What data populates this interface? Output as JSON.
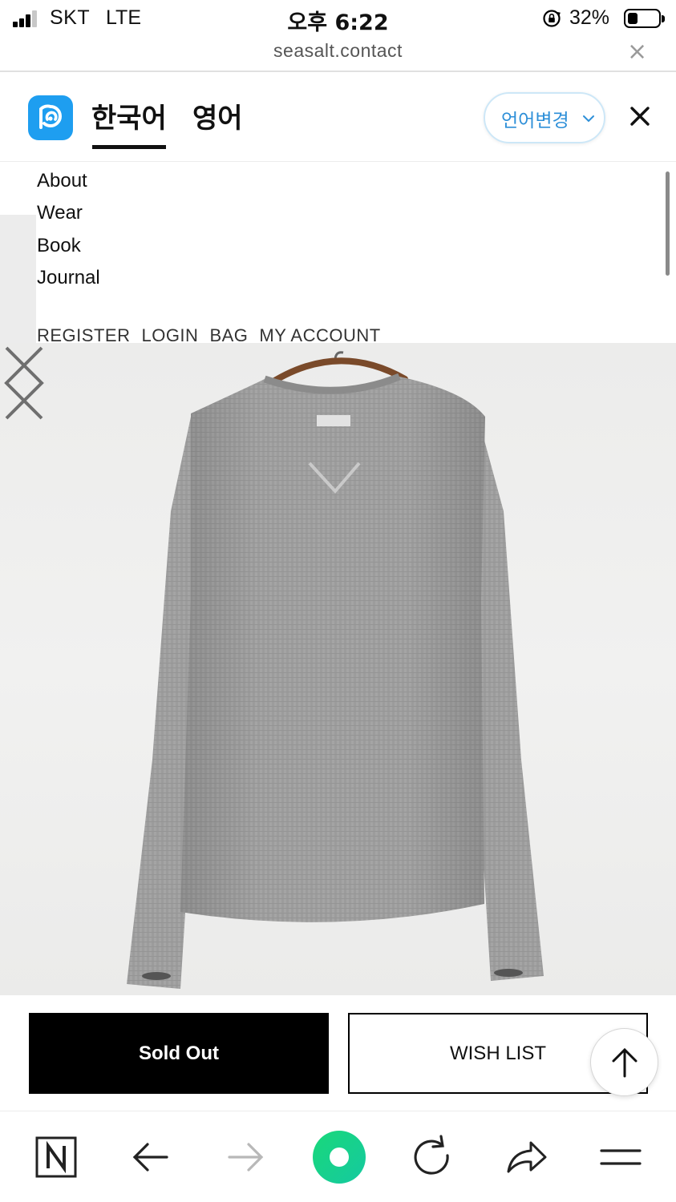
{
  "status_bar": {
    "carrier": "SKT",
    "network": "LTE",
    "time": "오후 6:22",
    "battery_percent_label": "32%",
    "battery_level": 0.32,
    "signal_bars": 3
  },
  "url_bar": {
    "url": "seasalt.contact",
    "close_glyph": "×"
  },
  "translate_bar": {
    "logo_icon": "papago-icon",
    "tabs": [
      {
        "label": "한국어",
        "active": true
      },
      {
        "label": "영어",
        "active": false
      }
    ],
    "language_change_label": "언어변경",
    "accent_color": "#1e9ef0"
  },
  "site_nav": {
    "items": [
      {
        "label": "About"
      },
      {
        "label": "Wear"
      },
      {
        "label": "Book"
      },
      {
        "label": "Journal"
      }
    ],
    "account_links": [
      {
        "label": "REGISTER"
      },
      {
        "label": "LOGIN"
      },
      {
        "label": "BAG"
      },
      {
        "label": "MY ACCOUNT"
      }
    ]
  },
  "product": {
    "image_icon": "grey-knit-sweater-photo",
    "prev_icon": "chevron-left-icon",
    "next_icon": "chevron-right-icon"
  },
  "actions": {
    "sold_out_label": "Sold Out",
    "wish_list_label": "WISH LIST",
    "scroll_top_icon": "arrow-up-icon"
  },
  "toolbar": {
    "items": [
      {
        "icon": "naver-n-icon"
      },
      {
        "icon": "back-arrow-icon"
      },
      {
        "icon": "forward-arrow-icon"
      },
      {
        "icon": "green-home-icon"
      },
      {
        "icon": "reload-icon"
      },
      {
        "icon": "share-icon"
      },
      {
        "icon": "menu-icon"
      }
    ],
    "home_color": "#22d46a"
  }
}
